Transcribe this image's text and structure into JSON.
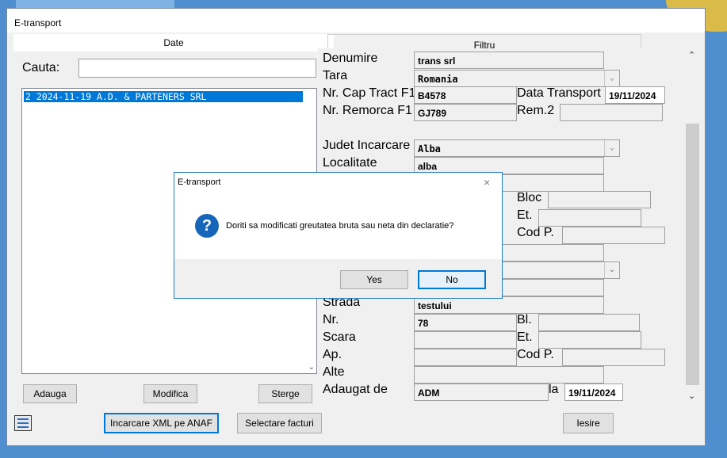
{
  "window": {
    "title": "E-transport"
  },
  "tabs": {
    "date": "Date",
    "filtru": "Filtru"
  },
  "search": {
    "label": "Cauta:",
    "value": ""
  },
  "list": {
    "items": [
      "2 2024-11-19 A.D. & PARTENERS SRL"
    ]
  },
  "left_buttons": {
    "adauga": "Adauga",
    "modifica": "Modifica",
    "sterge": "Sterge"
  },
  "bottom_buttons": {
    "incarcare": "Incarcare XML pe ANAF",
    "selectare": "Selectare facturi",
    "iesire": "Iesire"
  },
  "form": {
    "denumire_label": "Denumire",
    "denumire_value": "trans srl",
    "tara_label": "Tara",
    "tara_value": "Romania",
    "cap_tract_label": "Nr. Cap Tract F1",
    "cap_tract_value": "B4578",
    "data_transport_label": "Data Transport",
    "data_transport_value": "19/11/2024",
    "remorca_label": "Nr. Remorca F1",
    "remorca_value": "GJ789",
    "rem2_label": "Rem.2",
    "rem2_value": "",
    "judet_label": "Judet Incarcare",
    "judet_value": "Alba",
    "localitate_label": "Localitate",
    "localitate_value": "alba",
    "bloc_label": "Bloc",
    "et1_label": "Et.",
    "codp1_label": "Cod P.",
    "strada_label": "Strada",
    "strada_value": "testului",
    "nr_label": "Nr.",
    "nr_value": "78",
    "bl_label": "Bl.",
    "scara_label": "Scara",
    "et2_label": "Et.",
    "ap_label": "Ap.",
    "codp2_label": "Cod P.",
    "alte_label": "Alte",
    "adaugat_label": "Adaugat de",
    "adaugat_value": "ADM",
    "la_label": "la",
    "la_value": "19/11/2024"
  },
  "dialog": {
    "title": "E-transport",
    "message": "Doriti sa modificati greutatea bruta sau neta din declaratie?",
    "yes": "Yes",
    "no": "No",
    "icon": "question-icon"
  },
  "colors": {
    "accent": "#0078d7",
    "desktop": "#4f8fd0"
  }
}
